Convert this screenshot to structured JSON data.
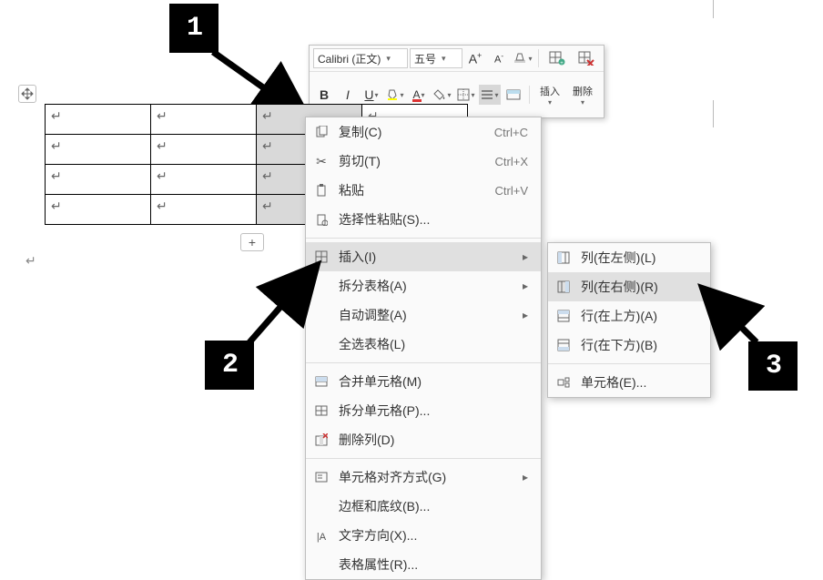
{
  "annotations": {
    "one": "1",
    "two": "2",
    "three": "3"
  },
  "toolbar": {
    "font_name": "Calibri (正文)",
    "font_size": "五号",
    "increase_font": "A",
    "decrease_font": "A",
    "bold": "B",
    "italic": "I",
    "underline": "U",
    "insert": "插入",
    "delete": "删除"
  },
  "table": {
    "rows": 4,
    "cols": 4,
    "cell_marker": "↵"
  },
  "context_menu": {
    "copy": {
      "label": "复制(C)",
      "shortcut": "Ctrl+C"
    },
    "cut": {
      "label": "剪切(T)",
      "shortcut": "Ctrl+X"
    },
    "paste": {
      "label": "粘贴",
      "shortcut": "Ctrl+V"
    },
    "paste_special": {
      "label": "选择性粘贴(S)..."
    },
    "insert": {
      "label": "插入(I)"
    },
    "split_table": {
      "label": "拆分表格(A)"
    },
    "autofit": {
      "label": "自动调整(A)"
    },
    "select_all": {
      "label": "全选表格(L)"
    },
    "merge_cells": {
      "label": "合并单元格(M)"
    },
    "split_cells": {
      "label": "拆分单元格(P)..."
    },
    "delete_col": {
      "label": "删除列(D)"
    },
    "cell_align": {
      "label": "单元格对齐方式(G)"
    },
    "borders": {
      "label": "边框和底纹(B)..."
    },
    "text_dir": {
      "label": "文字方向(X)..."
    },
    "table_props": {
      "label": "表格属性(R)..."
    }
  },
  "submenu": {
    "col_left": {
      "label": "列(在左侧)(L)"
    },
    "col_right": {
      "label": "列(在右侧)(R)"
    },
    "row_above": {
      "label": "行(在上方)(A)"
    },
    "row_below": {
      "label": "行(在下方)(B)"
    },
    "cells": {
      "label": "单元格(E)..."
    }
  }
}
